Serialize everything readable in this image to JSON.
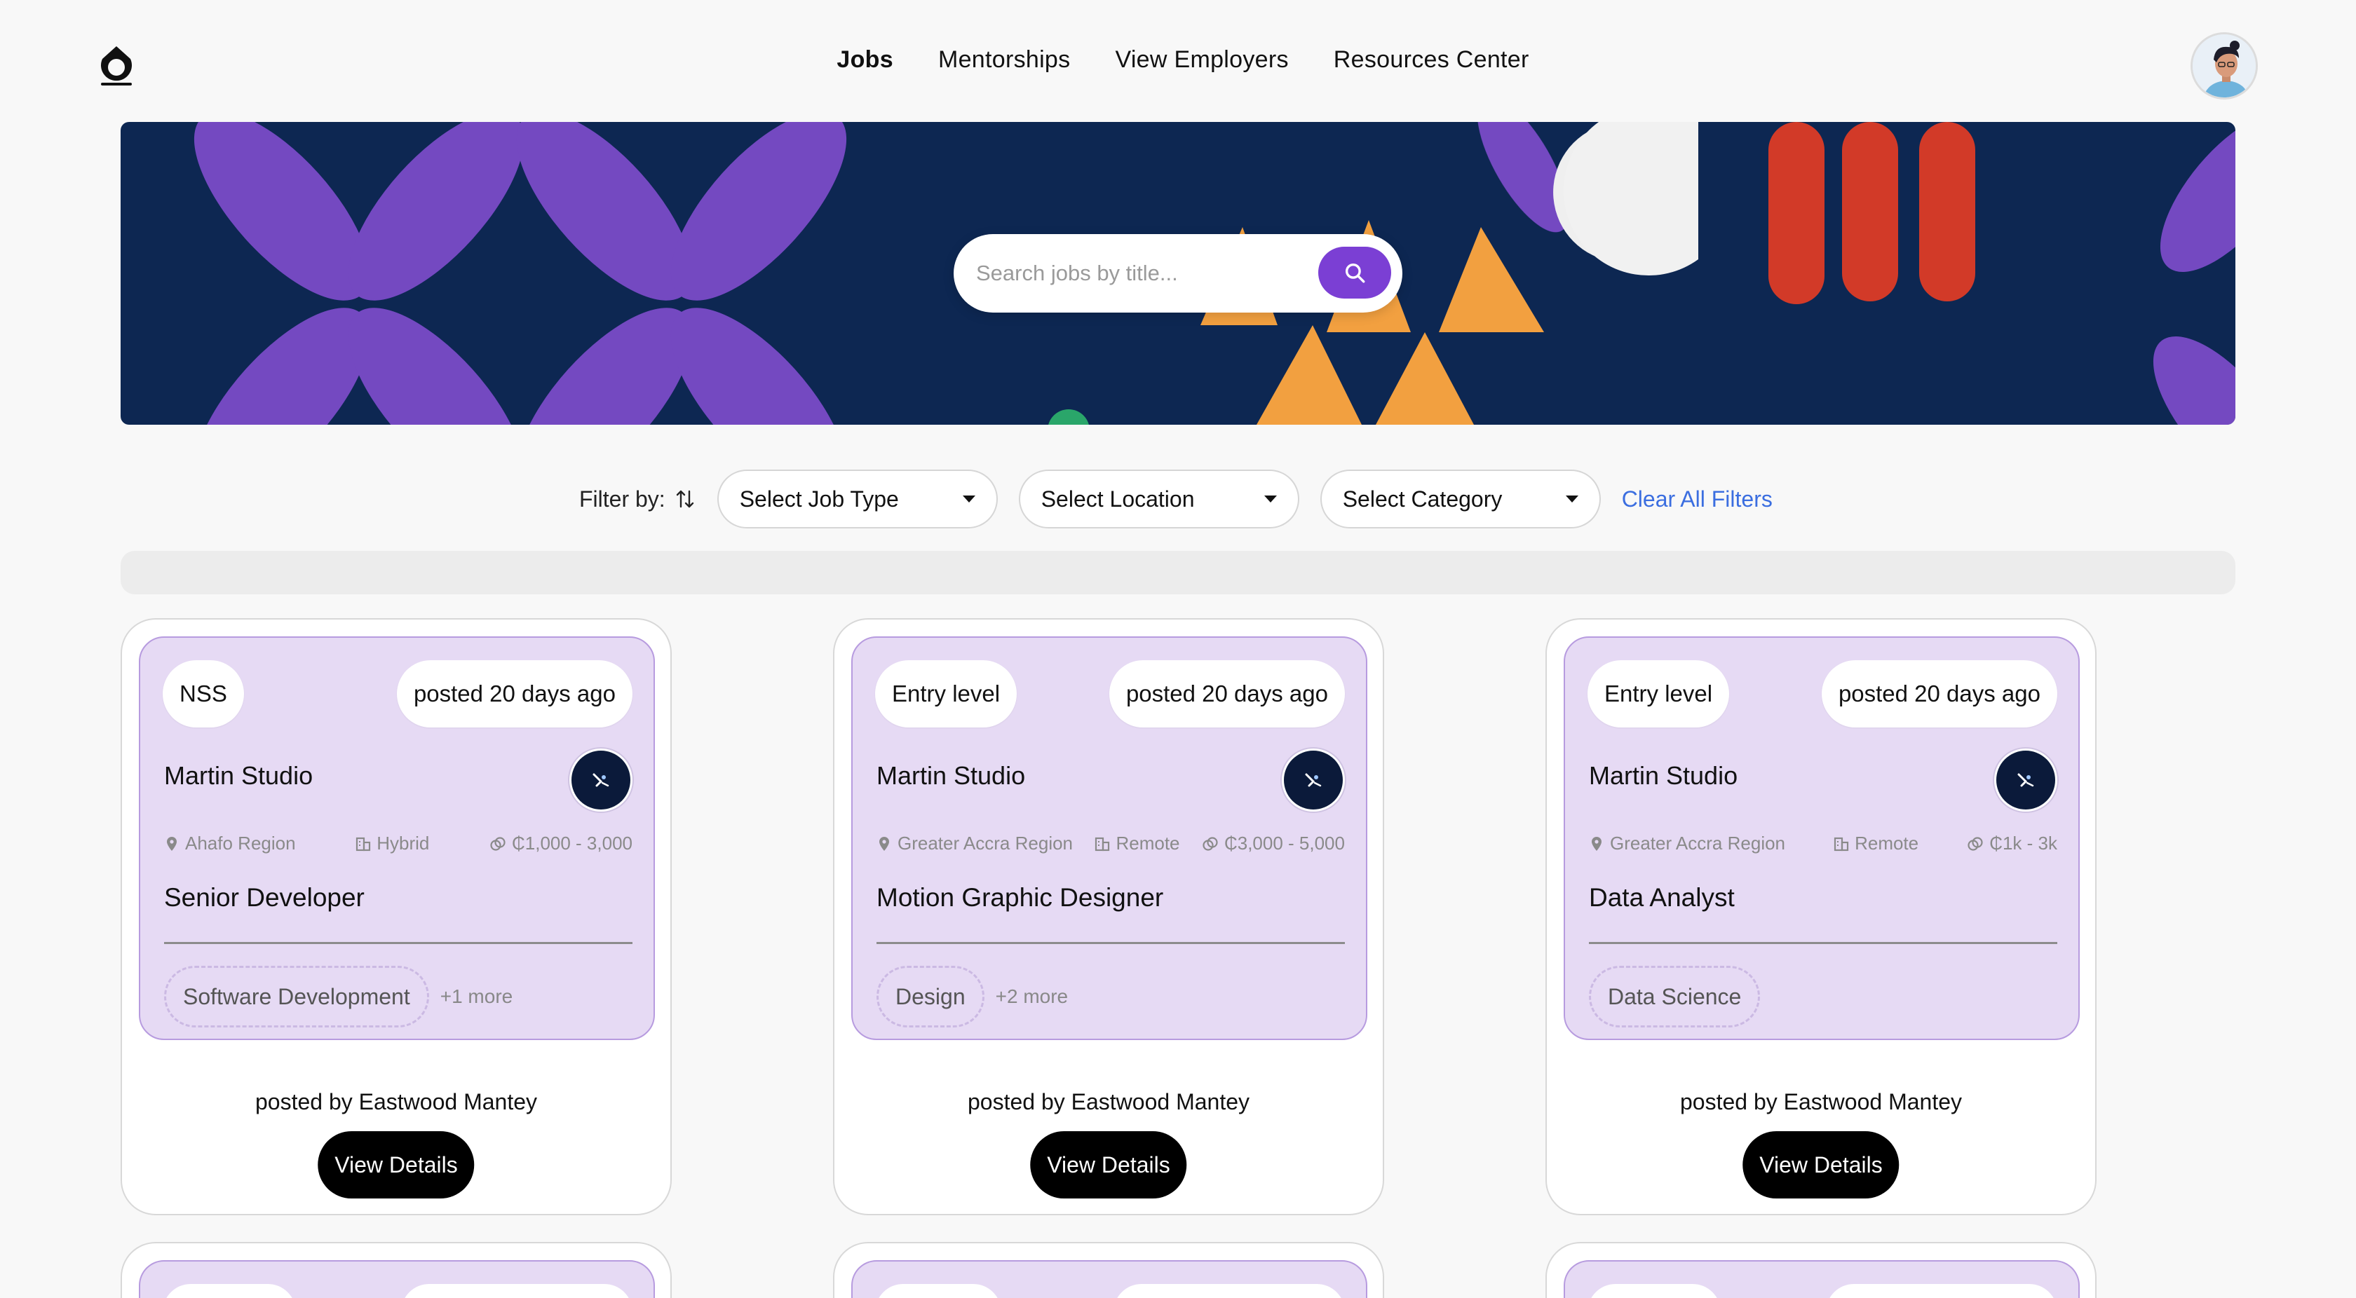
{
  "nav": {
    "logo_icon": "app-logo-icon",
    "links": [
      "Jobs",
      "Mentorships",
      "View Employers",
      "Resources Center"
    ],
    "active": "Jobs",
    "avatar_icon": "user-avatar"
  },
  "search": {
    "placeholder": "Search jobs by title...",
    "button_icon": "search-icon"
  },
  "filters": {
    "label": "Filter by:",
    "sort_icon": "sort-arrows-icon",
    "job_type": "Select Job Type",
    "location": "Select Location",
    "category": "Select Category",
    "clear": "Clear All Filters"
  },
  "jobs": [
    {
      "level": "NSS",
      "posted": "posted 20 days ago",
      "company": "Martin Studio",
      "location": "Ahafo Region",
      "work_mode": "Hybrid",
      "salary": "₵1,000 - 3,000",
      "title": "Senior Developer",
      "tag": "Software Development",
      "more": "+1 more",
      "posted_by": "posted by Eastwood Mantey",
      "button": "View Details"
    },
    {
      "level": "Entry level",
      "posted": "posted 20 days ago",
      "company": "Martin Studio",
      "location": "Greater Accra Region",
      "work_mode": "Remote",
      "salary": "₵3,000 - 5,000",
      "title": "Motion Graphic Designer",
      "tag": "Design",
      "more": "+2 more",
      "posted_by": "posted by Eastwood Mantey",
      "button": "View Details"
    },
    {
      "level": "Entry level",
      "posted": "posted 20 days ago",
      "company": "Martin Studio",
      "location": "Greater Accra Region",
      "work_mode": "Remote",
      "salary": "₵1k - 3k",
      "title": "Data Analyst",
      "tag": "Data Science",
      "more": "",
      "posted_by": "posted by Eastwood Mantey",
      "button": "View Details"
    }
  ],
  "colors": {
    "accent": "#7b3fd4",
    "card_bg": "#e6daf4",
    "hero_bg": "#0d2752",
    "link": "#3b6ee0"
  }
}
